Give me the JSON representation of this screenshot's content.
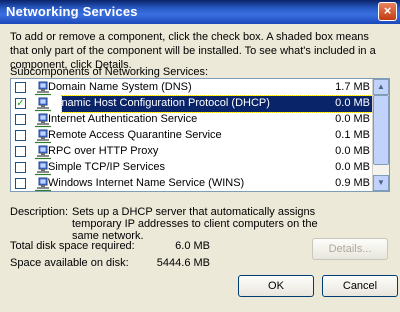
{
  "window": {
    "title": "Networking Services",
    "close_glyph": "×"
  },
  "intro_text": "To add or remove a component, click the check box. A shaded box means that only part of the component will be installed. To see what's included in a component, click Details.",
  "list_label": "Subcomponents of Networking Services:",
  "components": [
    {
      "name": "Domain Name System (DNS)",
      "size": "1.7 MB",
      "checked": false,
      "selected": false
    },
    {
      "name": "Dynamic Host Configuration Protocol (DHCP)",
      "size": "0.0 MB",
      "checked": true,
      "selected": true
    },
    {
      "name": "Internet Authentication Service",
      "size": "0.0 MB",
      "checked": false,
      "selected": false
    },
    {
      "name": "Remote Access Quarantine Service",
      "size": "0.1 MB",
      "checked": false,
      "selected": false
    },
    {
      "name": "RPC over HTTP Proxy",
      "size": "0.0 MB",
      "checked": false,
      "selected": false
    },
    {
      "name": "Simple TCP/IP Services",
      "size": "0.0 MB",
      "checked": false,
      "selected": false
    },
    {
      "name": "Windows Internet Name Service (WINS)",
      "size": "0.9 MB",
      "checked": false,
      "selected": false
    }
  ],
  "description": {
    "label": "Description:",
    "text": "Sets up a DHCP server that automatically assigns temporary IP addresses to client computers on the same network."
  },
  "disk": {
    "required_label": "Total disk space required:",
    "required_value": "6.0 MB",
    "available_label": "Space available on disk:",
    "available_value": "5444.6 MB"
  },
  "buttons": {
    "details": "Details...",
    "ok": "OK",
    "cancel": "Cancel"
  },
  "colors": {
    "selection": "#0a246a",
    "titlebar": "#2a5cc7",
    "dialog_bg": "#ece9d8"
  },
  "icons": {
    "component": "network-component-icon",
    "check": "check-mark-icon",
    "close": "close-icon"
  }
}
